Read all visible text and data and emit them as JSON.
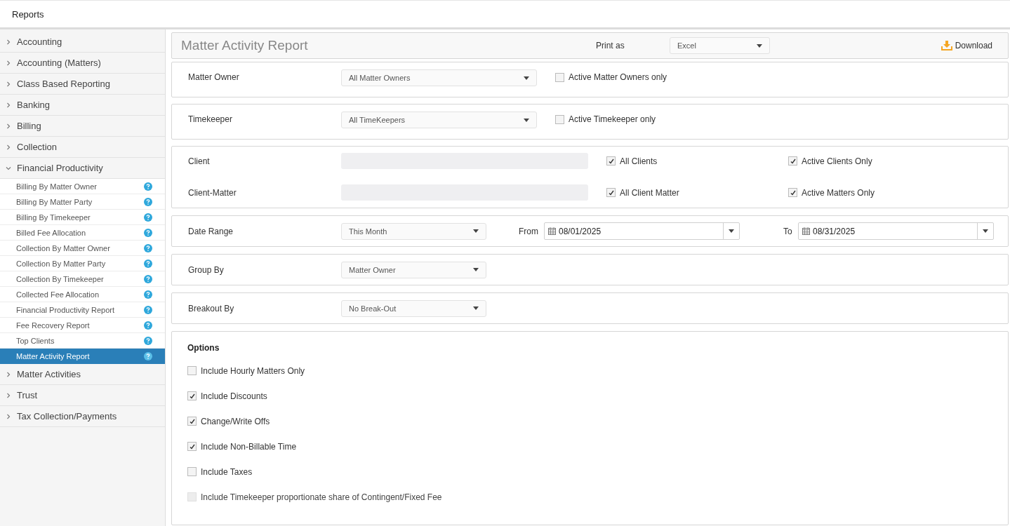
{
  "app_title": "Reports",
  "sidebar": {
    "groups": [
      {
        "label": "Accounting",
        "expanded": false
      },
      {
        "label": "Accounting (Matters)",
        "expanded": false
      },
      {
        "label": "Class Based Reporting",
        "expanded": false
      },
      {
        "label": "Banking",
        "expanded": false
      },
      {
        "label": "Billing",
        "expanded": false
      },
      {
        "label": "Collection",
        "expanded": false
      },
      {
        "label": "Financial Productivity",
        "expanded": true,
        "children": [
          {
            "label": "Billing By Matter Owner",
            "selected": false
          },
          {
            "label": "Billing By Matter Party",
            "selected": false
          },
          {
            "label": "Billing By Timekeeper",
            "selected": false
          },
          {
            "label": "Billed Fee Allocation",
            "selected": false
          },
          {
            "label": "Collection By Matter Owner",
            "selected": false
          },
          {
            "label": "Collection By Matter Party",
            "selected": false
          },
          {
            "label": "Collection By Timekeeper",
            "selected": false
          },
          {
            "label": "Collected Fee Allocation",
            "selected": false
          },
          {
            "label": "Financial Productivity Report",
            "selected": false
          },
          {
            "label": "Fee Recovery Report",
            "selected": false
          },
          {
            "label": "Top Clients",
            "selected": false
          },
          {
            "label": "Matter Activity Report",
            "selected": true
          }
        ]
      },
      {
        "label": "Matter Activities",
        "expanded": false
      },
      {
        "label": "Trust",
        "expanded": false
      },
      {
        "label": "Tax Collection/Payments",
        "expanded": false
      }
    ]
  },
  "report": {
    "title": "Matter Activity Report",
    "print_as": {
      "label": "Print as",
      "value": "Excel"
    },
    "download": "Download"
  },
  "matter_owner": {
    "label": "Matter Owner",
    "value": "All Matter Owners",
    "option": {
      "label": "Active Matter Owners only",
      "checked": false
    }
  },
  "timekeeper": {
    "label": "Timekeeper",
    "value": "All TimeKeepers",
    "option": {
      "label": "Active Timekeeper only",
      "checked": false
    }
  },
  "client_section": {
    "rows": [
      {
        "label": "Client",
        "all": {
          "label": "All Clients",
          "checked": true
        },
        "active": {
          "label": "Active Clients Only",
          "checked": true
        }
      },
      {
        "label": "Client-Matter",
        "all": {
          "label": "All Client Matter",
          "checked": true
        },
        "active": {
          "label": "Active Matters Only",
          "checked": true
        }
      }
    ]
  },
  "date_range": {
    "label": "Date Range",
    "value": "This Month",
    "from": {
      "label": "From",
      "value": "08/01/2025"
    },
    "to": {
      "label": "To",
      "value": "08/31/2025"
    }
  },
  "group_by": {
    "label": "Group By",
    "value": "Matter Owner"
  },
  "breakout_by": {
    "label": "Breakout By",
    "value": "No Break-Out"
  },
  "options": {
    "title": "Options",
    "items": [
      {
        "label": "Include Hourly Matters Only",
        "checked": false,
        "disabled": false
      },
      {
        "label": "Include Discounts",
        "checked": true,
        "disabled": false
      },
      {
        "label": "Change/Write Offs",
        "checked": true,
        "disabled": false
      },
      {
        "label": "Include Non-Billable Time",
        "checked": true,
        "disabled": false
      },
      {
        "label": "Include Taxes",
        "checked": false,
        "disabled": false
      },
      {
        "label": "Include Timekeeper proportionate share of Contingent/Fixed Fee",
        "checked": false,
        "disabled": true
      }
    ]
  }
}
